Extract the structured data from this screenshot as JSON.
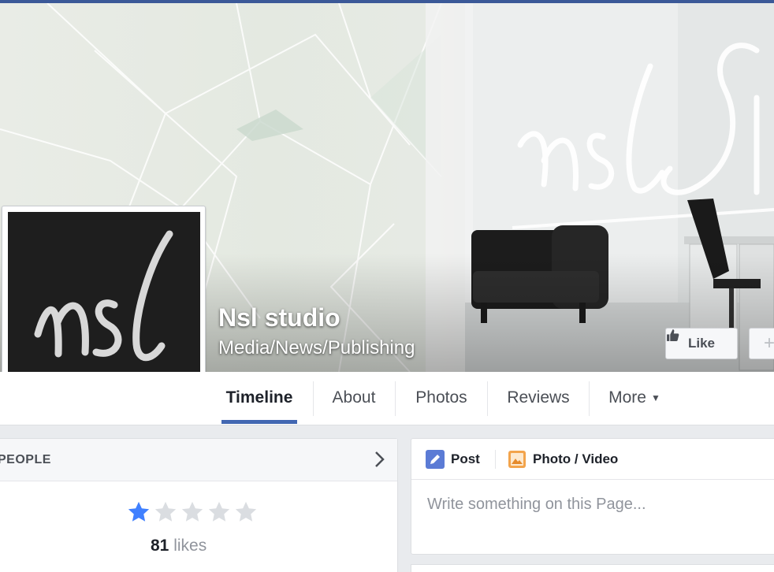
{
  "page": {
    "name": "Nsl studio",
    "category": "Media/News/Publishing",
    "logo_text": "nsl"
  },
  "cover": {
    "watermark_text": "nsl St"
  },
  "actions": {
    "like_label": "Like",
    "extra_label": "+"
  },
  "tabs": [
    {
      "label": "Timeline",
      "active": true
    },
    {
      "label": "About"
    },
    {
      "label": "Photos"
    },
    {
      "label": "Reviews"
    },
    {
      "label": "More"
    }
  ],
  "people": {
    "title": "PEOPLE",
    "rating_stars": 1,
    "rating_max": 5,
    "likes_count": "81",
    "likes_label": "likes"
  },
  "composer": {
    "post_label": "Post",
    "photo_video_label": "Photo / Video",
    "placeholder": "Write something on this Page..."
  },
  "colors": {
    "brand": "#3b5998",
    "tab_active_underline": "#4267b2",
    "star_filled": "#4080ff",
    "star_empty": "#dadde1"
  }
}
